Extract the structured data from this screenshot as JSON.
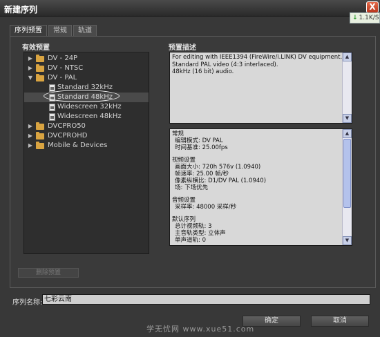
{
  "window": {
    "title": "新建序列",
    "close_label": "X"
  },
  "download_badge": {
    "text": "1.1K/S"
  },
  "tabs": [
    {
      "label": "序列预置",
      "active": true
    },
    {
      "label": "常规",
      "active": false
    },
    {
      "label": "轨道",
      "active": false
    }
  ],
  "presets": {
    "heading": "有效预置",
    "items": [
      {
        "label": "DV - 24P",
        "type": "folder",
        "expanded": false
      },
      {
        "label": "DV - NTSC",
        "type": "folder",
        "expanded": false
      },
      {
        "label": "DV - PAL",
        "type": "folder",
        "expanded": true
      },
      {
        "label": "Standard 32kHz",
        "type": "preset"
      },
      {
        "label": "Standard 48kHz",
        "type": "preset",
        "selected": true
      },
      {
        "label": "Widescreen 32kHz",
        "type": "preset"
      },
      {
        "label": "Widescreen 48kHz",
        "type": "preset"
      },
      {
        "label": "DVCPRO50",
        "type": "folder",
        "expanded": false
      },
      {
        "label": "DVCPROHD",
        "type": "folder",
        "expanded": false
      },
      {
        "label": "Mobile & Devices",
        "type": "folder",
        "expanded": false
      }
    ]
  },
  "description": {
    "heading": "预置描述",
    "lines": [
      "For editing with IEEE1394 (FireWire/i.LINK) DV equipment.",
      "Standard PAL video (4:3 interlaced).",
      "48kHz (16 bit) audio."
    ]
  },
  "info": {
    "sections": [
      {
        "title": "常规",
        "lines": [
          "编辑模式: DV PAL",
          "时间基准: 25.00fps"
        ]
      },
      {
        "title": "视频设置",
        "lines": [
          "画面大小: 720h 576v (1.0940)",
          "帧速率: 25.00 帧/秒",
          "像素纵横比: D1/DV PAL (1.0940)",
          "场: 下场优先"
        ]
      },
      {
        "title": "音频设置",
        "lines": [
          "采样率: 48000 采样/秒"
        ]
      },
      {
        "title": "默认序列",
        "lines": [
          "总计视频轨: 3",
          "主音轨类型: 立体声",
          "单声道轨: 0"
        ]
      }
    ]
  },
  "delete_preset_label": "删除预置",
  "sequence_name": {
    "label": "序列名称:",
    "value": "七彩云南"
  },
  "ok_label": "确定",
  "cancel_label": "取消",
  "watermark": "学无忧网  www.xue51.com"
}
